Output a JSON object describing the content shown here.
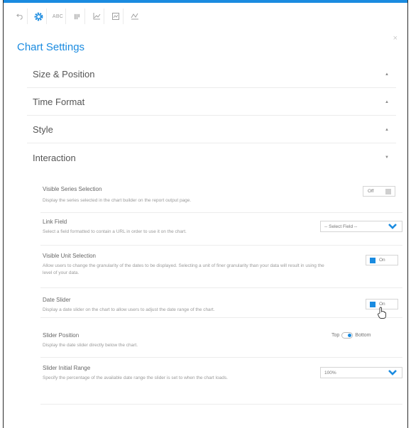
{
  "toolbar": {
    "items": [
      {
        "icon": "undo-icon"
      },
      {
        "icon": "gear-icon",
        "active": true
      },
      {
        "icon": "abc-text-icon",
        "label": "ABC"
      },
      {
        "icon": "columns-icon"
      },
      {
        "icon": "axis-chart-icon"
      },
      {
        "icon": "frame-icon"
      },
      {
        "icon": "line-chart-icon"
      }
    ]
  },
  "close_label": "×",
  "title": "Chart Settings",
  "sections": [
    {
      "label": "Size & Position",
      "chevron": "▲"
    },
    {
      "label": "Time Format",
      "chevron": "▲"
    },
    {
      "label": "Style",
      "chevron": "▲"
    },
    {
      "label": "Interaction",
      "chevron": "▼"
    }
  ],
  "settings": {
    "visible_series": {
      "name": "Visible Series Selection",
      "desc": "Display the series selected in the chart builder on the report output page.",
      "toggle": "Off"
    },
    "link_field": {
      "name": "Link Field",
      "desc": "Select a field formatted to contain a URL in order to use it on the chart.",
      "select": "-- Select Field --"
    },
    "visible_unit": {
      "name": "Visible Unit Selection",
      "desc": "Allow users to change the granularity of the dates to be displayed. Selecting a unit of finer granularity than your data will result in using the level of your data.",
      "toggle": "On"
    },
    "date_slider": {
      "name": "Date Slider",
      "desc": "Display a date slider on the chart to allow users to adjust the date range of the chart.",
      "toggle": "On"
    },
    "slider_position": {
      "name": "Slider Position",
      "desc": "Display the date slider directly below the chart.",
      "option_left": "Top",
      "option_right": "Bottom",
      "selected": "Bottom"
    },
    "slider_range": {
      "name": "Slider Initial Range",
      "desc": "Specify the percentage of the available date range the slider is set to when the chart loads.",
      "select": "100%"
    }
  },
  "colors": {
    "accent": "#1a8be0",
    "text": "#555555",
    "muted": "#9a9a9a",
    "border": "#d5d5d5"
  }
}
